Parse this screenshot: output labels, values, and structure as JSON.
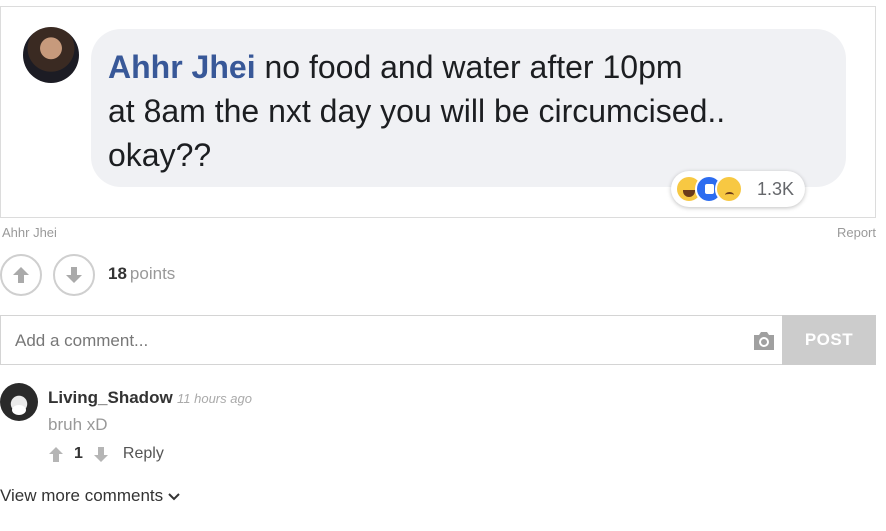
{
  "post": {
    "fb_author": "Ahhr Jhei",
    "fb_message_line1": " no food and water after 10pm",
    "fb_message_line2": "at 8am the nxt day you will be circumcised..",
    "fb_message_line3": "okay??",
    "fb_reaction_count": "1.3K",
    "meta_author": "Ahhr Jhei",
    "report_label": "Report",
    "points_value": "18",
    "points_label": "points"
  },
  "comment_form": {
    "placeholder": "Add a comment...",
    "post_label": "POST"
  },
  "comments": [
    {
      "username": "Living_Shadow",
      "time": "11 hours ago",
      "text": "bruh xD",
      "votes": "1",
      "reply_label": "Reply"
    }
  ],
  "view_more_label": "View more comments",
  "icons": {
    "upvote": "arrow-up-icon",
    "downvote": "arrow-down-icon",
    "camera": "camera-icon",
    "chevron": "chevron-down-icon"
  },
  "colors": {
    "fb_author": "#385898",
    "post_button_bg": "#cccccc",
    "muted_text": "#999999"
  }
}
